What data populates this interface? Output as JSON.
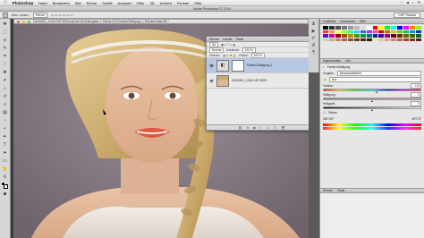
{
  "menubar": {
    "app_name": "Photoshop",
    "items": [
      "Datei",
      "Bearbeiten",
      "Bild",
      "Ebene",
      "Schrift",
      "Auswahl",
      "Filter",
      "3D",
      "Ansicht",
      "Fenster",
      "Hilfe"
    ]
  },
  "window": {
    "title": "Adobe Photoshop CC 2014"
  },
  "options": {
    "auto_select_label": "Auto.-Ausw.:",
    "auto_select_value": "Ebene",
    "workspace": "CAP-Tutorial"
  },
  "document": {
    "tab_title": "20140501_1218-CAP-8209.psd bei Einzeliangabe 1, Ebene 23 (Farbton/Sättigung 1, Ebenenmaske/8) *"
  },
  "layers_panel": {
    "tabs": [
      "Ebenen",
      "Kanäle",
      "Pfade"
    ],
    "filter_label": "Art",
    "blend_mode": "Normal",
    "opacity_label": "Deckkraft:",
    "opacity_value": "100 %",
    "lock_label": "Fixieren:",
    "fill_label": "Fläche:",
    "fill_value": "100 %",
    "layers": [
      {
        "name": "Farbton/Sättigung 1",
        "active": true
      },
      {
        "name": "20140501_1218-CAP-8209",
        "active": false
      }
    ]
  },
  "right_dock": {
    "top_tabs": [
      "Farbfelder",
      "Korrekturen",
      "Stile"
    ],
    "properties_tabs": [
      "Eigenschaften",
      "Info"
    ],
    "properties_title": "Farbton/Sättigung",
    "preset_label": "Vorgabe:",
    "preset_value": "Benutzerdefiniert",
    "channel_value": "Rot",
    "hue_label": "Farbton:",
    "hue_value": "+12",
    "hue_level": 0.55,
    "saturation_label": "Sättigung:",
    "saturation_value": "0",
    "saturation_level": 0.5,
    "lightness_label": "Helligkeit:",
    "lightness_value": "0",
    "lightness_level": 0.5,
    "colorize_label": "Färben",
    "range_left": "345°/15°",
    "range_right": "45°\\75°",
    "bottom_tabs": [
      "Ebenen",
      "Pfade"
    ]
  },
  "colors": {
    "accent_selection": "#b6c8e4",
    "swatches": [
      "#000000",
      "#333333",
      "#555555",
      "#777777",
      "#999999",
      "#bbbbbb",
      "#dddddd",
      "#ffffff",
      "#ff0000",
      "#ffff00",
      "#00ff00",
      "#00ffff",
      "#0000ff",
      "#ff00ff",
      "#ff8000",
      "#80ff00",
      "#ff3333",
      "#ff9933",
      "#ffff66",
      "#99ff33",
      "#33ff99",
      "#33ccff",
      "#3366ff",
      "#9933ff",
      "#ff33cc",
      "#cc0000",
      "#cc6600",
      "#cccc00",
      "#66cc00",
      "#00cc66",
      "#0099cc",
      "#0033cc",
      "#6600cc",
      "#cc0099",
      "#990000",
      "#994c00",
      "#999900",
      "#4c9900",
      "#00994c",
      "#007399",
      "#002699",
      "#4c0099",
      "#990073",
      "#660000",
      "#663300",
      "#666600",
      "#336600",
      "#006633",
      "#f2c6a0",
      "#e0a67a",
      "#c8865a",
      "#a8683e",
      "#8a4e2a",
      "#6a3a1e",
      "#4a2814",
      "#2e180a",
      "#fde0d0",
      "#f7c0a8",
      "#eba085",
      "#d98065",
      "#c26048",
      "#a44632",
      "#82301e",
      "#5e1e10"
    ]
  }
}
